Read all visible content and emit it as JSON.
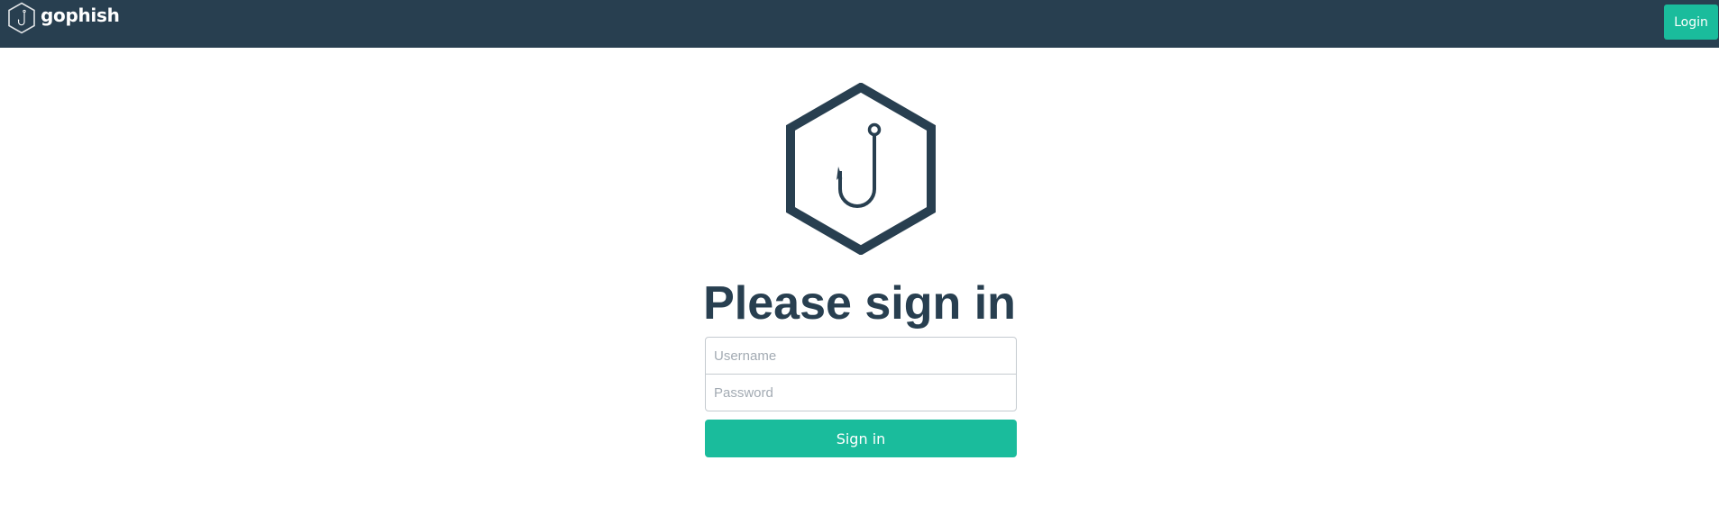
{
  "navbar": {
    "brand_name": "gophish",
    "brand_icon": "hexagon-hook-icon",
    "login_label": "Login",
    "background_color": "#283f50",
    "accent_color": "#1abc9c"
  },
  "main": {
    "logo_icon": "hexagon-hook-icon",
    "heading": "Please sign in",
    "username": {
      "value": "",
      "placeholder": "Username"
    },
    "password": {
      "value": "",
      "placeholder": "Password"
    },
    "signin_label": "Sign in",
    "text_color": "#283f50"
  }
}
